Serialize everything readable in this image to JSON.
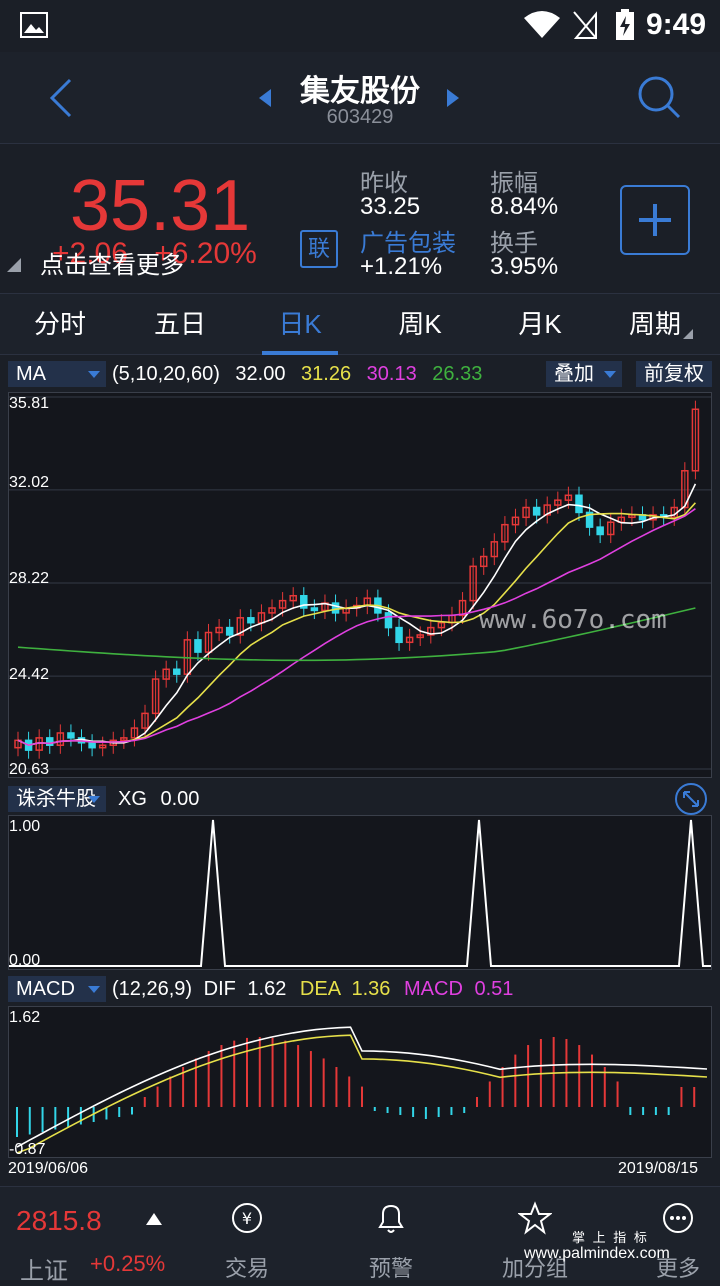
{
  "status_bar": {
    "time": "9:49"
  },
  "header": {
    "title": "集友股份",
    "code": "603429"
  },
  "quote": {
    "price": "35.31",
    "change": "+2.06",
    "change_pct": "+6.20%",
    "tip": "点击查看更多",
    "lian": "联",
    "prev_close_label": "昨收",
    "prev_close_value": "33.25",
    "ad_label": "广告包装",
    "ad_value": "+1.21%",
    "amplitude_label": "振幅",
    "amplitude_value": "8.84%",
    "turnover_label": "换手",
    "turnover_value": "3.95%",
    "add_icon": "plus-icon"
  },
  "tabs": [
    "分时",
    "五日",
    "日K",
    "周K",
    "月K",
    "周期"
  ],
  "active_tab": "日K",
  "ma_bar": {
    "selector": "MA",
    "params": "(5,10,20,60)",
    "ma5": "32.00",
    "ma10": "31.26",
    "ma20": "30.13",
    "ma60": "26.33",
    "overlay": "叠加",
    "adjust": "前复权"
  },
  "price_axis": [
    "35.81",
    "32.02",
    "28.22",
    "24.42",
    "20.63"
  ],
  "watermark_text": "www.6o7o.com",
  "xg_bar": {
    "selector": "诛杀牛股",
    "label": "XG",
    "value": "0.00",
    "axis_top": "1.00",
    "axis_bottom": "0.00"
  },
  "macd_bar": {
    "selector": "MACD",
    "params": "(12,26,9)",
    "dif_label": "DIF",
    "dif_value": "1.62",
    "dea_label": "DEA",
    "dea_value": "1.36",
    "macd_label": "MACD",
    "macd_value": "0.51",
    "axis_top": "1.62",
    "axis_bottom": "-0.87"
  },
  "date_start": "2019/06/06",
  "date_end": "2019/08/15",
  "bottom": {
    "index_value": "2815.8",
    "index_name": "上证",
    "index_change": "+0.25%",
    "nav": [
      "交易",
      "预警",
      "加分组",
      "更多"
    ],
    "logo_text": "掌 上 指 标",
    "logo_url": "www.palmindex.com"
  },
  "colors": {
    "up": "#e53838",
    "down": "#32d6e8",
    "accent": "#3a7bd5",
    "ma5": "#ffffff",
    "ma10": "#e6e04a",
    "ma20": "#e040e0",
    "ma60": "#3fb13f"
  },
  "chart_data": {
    "type": "candlestick",
    "ylim": [
      20.63,
      35.81
    ],
    "x_range": [
      "2019/06/06",
      "2019/08/15"
    ],
    "last_close": 35.31,
    "ma": {
      "MA5": 32.0,
      "MA10": 31.26,
      "MA20": 30.13,
      "MA60": 26.33
    },
    "xg_signal_peaks": 3,
    "macd": {
      "DIF": 1.62,
      "DEA": 1.36,
      "MACD": 0.51,
      "ylim": [
        -0.87,
        1.62
      ]
    }
  }
}
